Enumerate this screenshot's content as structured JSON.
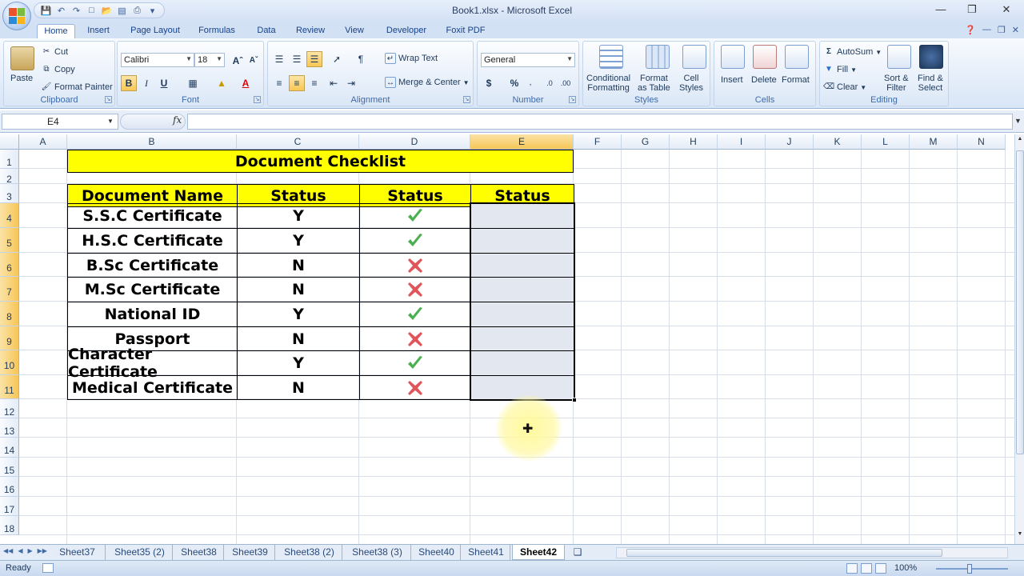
{
  "window": {
    "title": "Book1.xlsx - Microsoft Excel"
  },
  "ribbon_tabs": [
    "Home",
    "Insert",
    "Page Layout",
    "Formulas",
    "Data",
    "Review",
    "View",
    "Developer",
    "Foxit PDF"
  ],
  "clipboard": {
    "paste": "Paste",
    "cut": "Cut",
    "copy": "Copy",
    "format_painter": "Format Painter",
    "label": "Clipboard"
  },
  "font": {
    "name": "Calibri",
    "size": "18",
    "bold": "B",
    "italic": "I",
    "underline": "U",
    "label": "Font"
  },
  "alignment": {
    "wrap_text": "Wrap Text",
    "merge_center": "Merge & Center",
    "label": "Alignment"
  },
  "number": {
    "format": "General",
    "currency": "$",
    "percent": "%",
    "label": "Number"
  },
  "styles": {
    "conditional": "Conditional",
    "formatting": "Formatting",
    "format_as": "Format",
    "as_table": "as Table",
    "cell": "Cell",
    "cell_styles": "Styles",
    "label": "Styles"
  },
  "cells_group": {
    "insert": "Insert",
    "delete": "Delete",
    "format": "Format",
    "label": "Cells"
  },
  "editing": {
    "autosum": "AutoSum",
    "fill": "Fill",
    "clear": "Clear",
    "sort": "Sort &",
    "filter": "Filter",
    "find": "Find &",
    "select": "Select",
    "label": "Editing"
  },
  "formula_bar": {
    "name_box": "E4",
    "fx": "fx",
    "value": ""
  },
  "columns": [
    "A",
    "B",
    "C",
    "D",
    "E",
    "F",
    "G",
    "H",
    "I",
    "J",
    "K",
    "L",
    "M",
    "N"
  ],
  "rows": [
    "1",
    "2",
    "3",
    "4",
    "5",
    "6",
    "7",
    "8",
    "9",
    "10",
    "11",
    "12",
    "13",
    "14",
    "15",
    "16",
    "17",
    "18"
  ],
  "sheet": {
    "title": "Document Checklist",
    "headers": [
      "Document Name",
      "Status",
      "Status",
      "Status"
    ],
    "records": [
      {
        "name": "S.S.C Certificate",
        "status": "Y",
        "mark": "check"
      },
      {
        "name": "H.S.C Certificate",
        "status": "Y",
        "mark": "check"
      },
      {
        "name": "B.Sc Certificate",
        "status": "N",
        "mark": "cross"
      },
      {
        "name": "M.Sc Certificate",
        "status": "N",
        "mark": "cross"
      },
      {
        "name": "National ID",
        "status": "Y",
        "mark": "check"
      },
      {
        "name": "Passport",
        "status": "N",
        "mark": "cross"
      },
      {
        "name": "Character Certificate",
        "status": "Y",
        "mark": "check"
      },
      {
        "name": "Medical Certificate",
        "status": "N",
        "mark": "cross"
      }
    ],
    "check_color": "#4caf50",
    "cross_color": "#e0555a",
    "highlight_color": "#ffff00"
  },
  "sheet_tabs": [
    "Sheet37",
    "Sheet35 (2)",
    "Sheet38",
    "Sheet39",
    "Sheet38 (2)",
    "Sheet38 (3)",
    "Sheet40",
    "Sheet41",
    "Sheet42"
  ],
  "active_sheet": "Sheet42",
  "status": {
    "ready": "Ready",
    "zoom": "100%"
  }
}
